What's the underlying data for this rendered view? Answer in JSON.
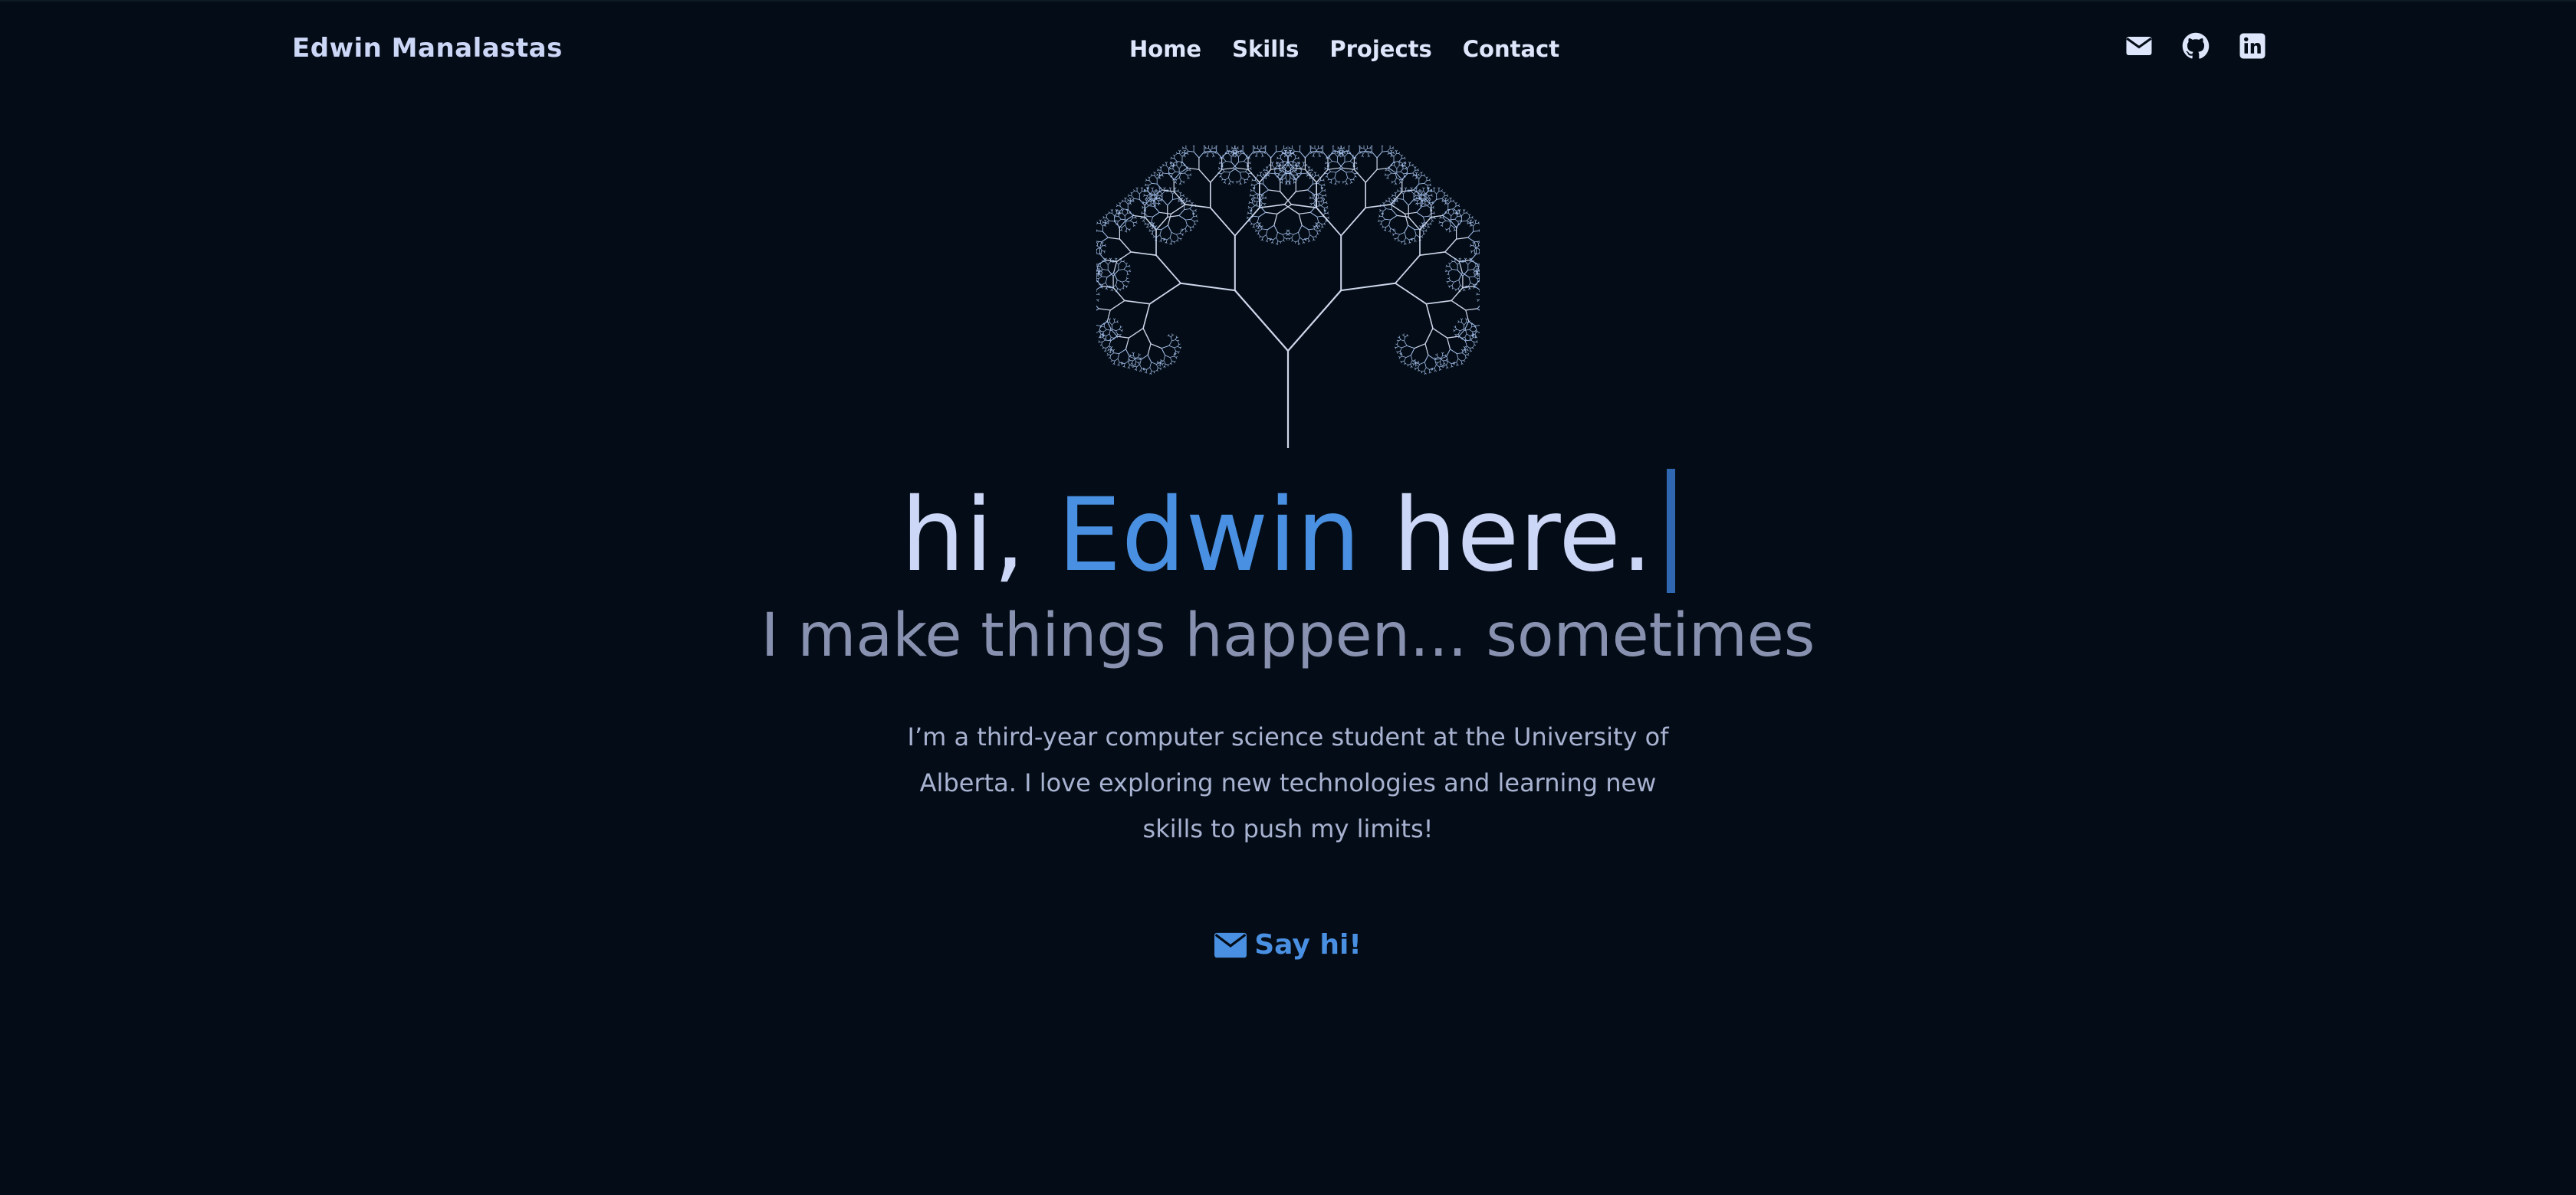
{
  "header": {
    "brand": "Edwin Manalastas",
    "nav": [
      "Home",
      "Skills",
      "Projects",
      "Contact"
    ],
    "social_icons": [
      "email-icon",
      "github-icon",
      "linkedin-icon"
    ]
  },
  "hero": {
    "greeting_prefix": "hi, ",
    "greeting_name": "Edwin",
    "greeting_suffix": " here.",
    "tagline": "I make things happen... sometimes",
    "intro": "I’m a third-year computer science student at the University of Alberta. I love exploring new technologies and learning new skills to push my limits!",
    "cta_label": "Say hi!",
    "cta_icon": "envelope-icon"
  },
  "colors": {
    "background": "#040d17",
    "text": "#ccd6f6",
    "muted": "#8892b0",
    "accent": "#4a90e2"
  }
}
